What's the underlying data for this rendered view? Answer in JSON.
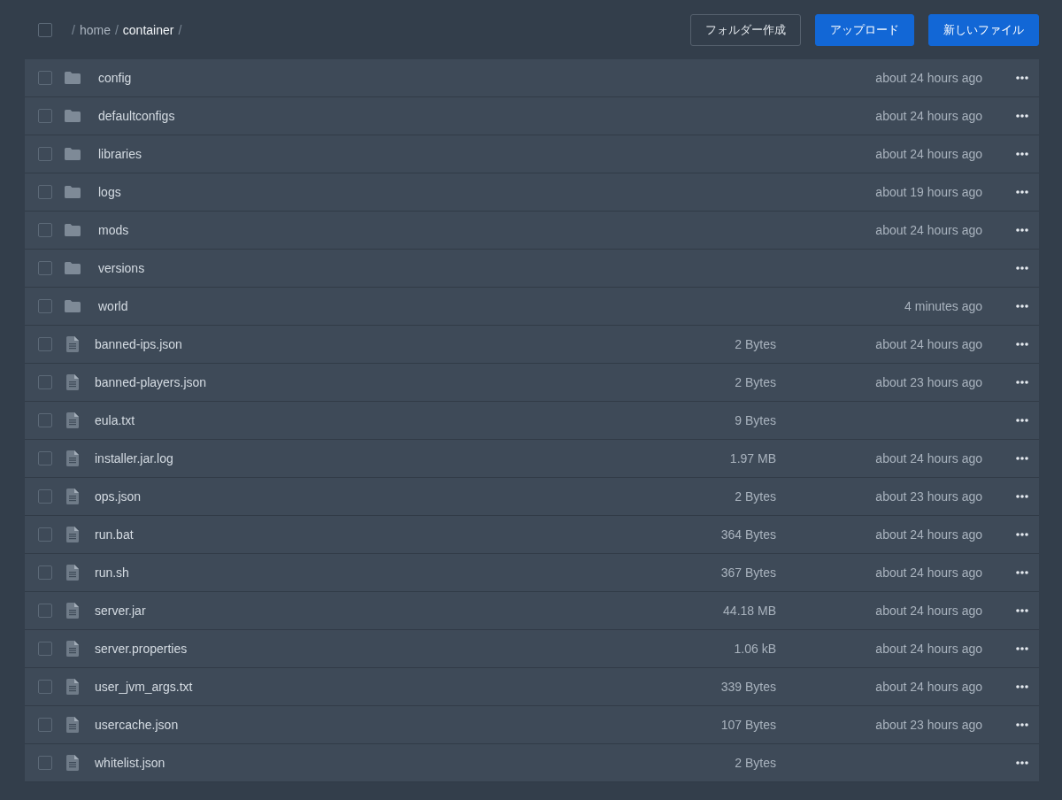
{
  "breadcrumb": {
    "select_all": {
      "checked": false
    },
    "parts": [
      {
        "kind": "separator",
        "text": "/"
      },
      {
        "kind": "link",
        "text": "home"
      },
      {
        "kind": "separator",
        "text": "/"
      },
      {
        "kind": "current",
        "text": "container"
      },
      {
        "kind": "separator",
        "text": "/"
      }
    ]
  },
  "actions": [
    {
      "label": "フォルダー作成",
      "kind": "secondary"
    },
    {
      "label": "アップロード",
      "kind": "primary"
    },
    {
      "label": "新しいファイル",
      "kind": "primary"
    }
  ],
  "files": [
    {
      "kind": "folder",
      "name": "config",
      "checked": false,
      "modified": "about 24 hours ago"
    },
    {
      "kind": "folder",
      "name": "defaultconfigs",
      "checked": false,
      "modified": "about 24 hours ago"
    },
    {
      "kind": "folder",
      "name": "libraries",
      "checked": false,
      "modified": "about 24 hours ago"
    },
    {
      "kind": "folder",
      "name": "logs",
      "checked": false,
      "modified": "about 19 hours ago"
    },
    {
      "kind": "folder",
      "name": "mods",
      "checked": false,
      "modified": "about 24 hours ago"
    },
    {
      "kind": "folder",
      "name": "versions",
      "checked": false
    },
    {
      "kind": "folder",
      "name": "world",
      "checked": false,
      "modified": "4 minutes ago"
    },
    {
      "kind": "file",
      "name": "banned-ips.json",
      "checked": false,
      "size": "2 Bytes",
      "modified": "about 24 hours ago"
    },
    {
      "kind": "file",
      "name": "banned-players.json",
      "checked": false,
      "size": "2 Bytes",
      "modified": "about 23 hours ago"
    },
    {
      "kind": "file",
      "name": "eula.txt",
      "checked": false,
      "size": "9 Bytes"
    },
    {
      "kind": "file",
      "name": "installer.jar.log",
      "checked": false,
      "size": "1.97 MB",
      "modified": "about 24 hours ago"
    },
    {
      "kind": "file",
      "name": "ops.json",
      "checked": false,
      "size": "2 Bytes",
      "modified": "about 23 hours ago"
    },
    {
      "kind": "file",
      "name": "run.bat",
      "checked": false,
      "size": "364 Bytes",
      "modified": "about 24 hours ago"
    },
    {
      "kind": "file",
      "name": "run.sh",
      "checked": false,
      "size": "367 Bytes",
      "modified": "about 24 hours ago"
    },
    {
      "kind": "file",
      "name": "server.jar",
      "checked": false,
      "size": "44.18 MB",
      "modified": "about 24 hours ago"
    },
    {
      "kind": "file",
      "name": "server.properties",
      "checked": false,
      "size": "1.06 kB",
      "modified": "about 24 hours ago"
    },
    {
      "kind": "file",
      "name": "user_jvm_args.txt",
      "checked": false,
      "size": "339 Bytes",
      "modified": "about 24 hours ago"
    },
    {
      "kind": "file",
      "name": "usercache.json",
      "checked": false,
      "size": "107 Bytes",
      "modified": "about 23 hours ago"
    },
    {
      "kind": "file",
      "name": "whitelist.json",
      "checked": false,
      "size": "2 Bytes"
    }
  ]
}
